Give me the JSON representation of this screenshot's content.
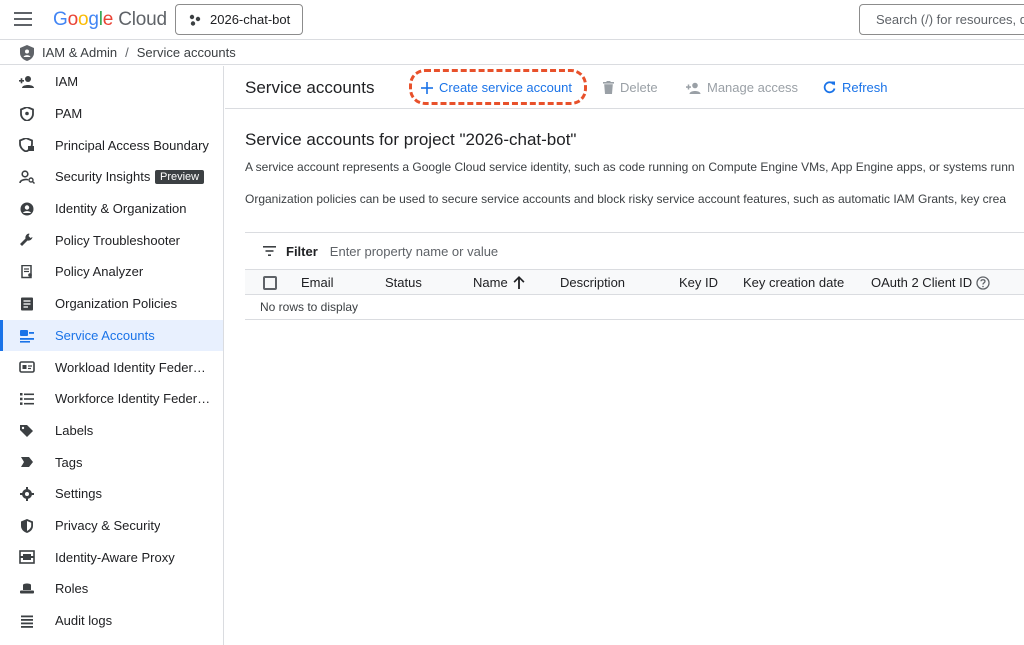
{
  "topbar": {
    "logo_parts": [
      "G",
      "o",
      "o",
      "g",
      "l",
      "e"
    ],
    "logo_cloud": "Cloud",
    "project": "2026-chat-bot",
    "search_placeholder": "Search (/) for resources, do"
  },
  "breadcrumb": {
    "section": "IAM & Admin",
    "separator": "/",
    "page": "Service accounts"
  },
  "sidebar": {
    "items": [
      {
        "label": "IAM",
        "icon": "person-add-icon"
      },
      {
        "label": "PAM",
        "icon": "shield-icon"
      },
      {
        "label": "Principal Access Boundary",
        "icon": "shield-lock-icon"
      },
      {
        "label": "Security Insights",
        "icon": "person-search-icon",
        "badge": "Preview"
      },
      {
        "label": "Identity & Organization",
        "icon": "account-circle-icon"
      },
      {
        "label": "Policy Troubleshooter",
        "icon": "wrench-icon"
      },
      {
        "label": "Policy Analyzer",
        "icon": "document-search-icon"
      },
      {
        "label": "Organization Policies",
        "icon": "list-box-icon"
      },
      {
        "label": "Service Accounts",
        "icon": "service-account-icon",
        "active": true
      },
      {
        "label": "Workload Identity Federation",
        "icon": "id-card-icon"
      },
      {
        "label": "Workforce Identity Federation",
        "icon": "list-icon"
      },
      {
        "label": "Labels",
        "icon": "label-icon"
      },
      {
        "label": "Tags",
        "icon": "tag-icon"
      },
      {
        "label": "Settings",
        "icon": "gear-icon"
      },
      {
        "label": "Privacy & Security",
        "icon": "privacy-shield-icon"
      },
      {
        "label": "Identity-Aware Proxy",
        "icon": "proxy-icon"
      },
      {
        "label": "Roles",
        "icon": "roles-hat-icon"
      },
      {
        "label": "Audit logs",
        "icon": "audit-list-icon"
      }
    ]
  },
  "toolbar": {
    "title": "Service accounts",
    "create_label": "Create service account",
    "delete_label": "Delete",
    "manage_label": "Manage access",
    "refresh_label": "Refresh",
    "highlight_color": "#e8512b"
  },
  "content": {
    "heading": "Service accounts for project \"2026-chat-bot\"",
    "description1": "A service account represents a Google Cloud service identity, such as code running on Compute Engine VMs, App Engine apps, or systems runn",
    "description2": "Organization policies can be used to secure service accounts and block risky service account features, such as automatic IAM Grants, key crea"
  },
  "table": {
    "filter_label": "Filter",
    "filter_placeholder": "Enter property name or value",
    "columns": [
      "Email",
      "Status",
      "Name",
      "Description",
      "Key ID",
      "Key creation date",
      "OAuth 2 Client ID"
    ],
    "sorted_column": "Name",
    "empty_text": "No rows to display"
  },
  "colors": {
    "accent": "#1a73e8",
    "active_bg": "#e8f0fe"
  }
}
